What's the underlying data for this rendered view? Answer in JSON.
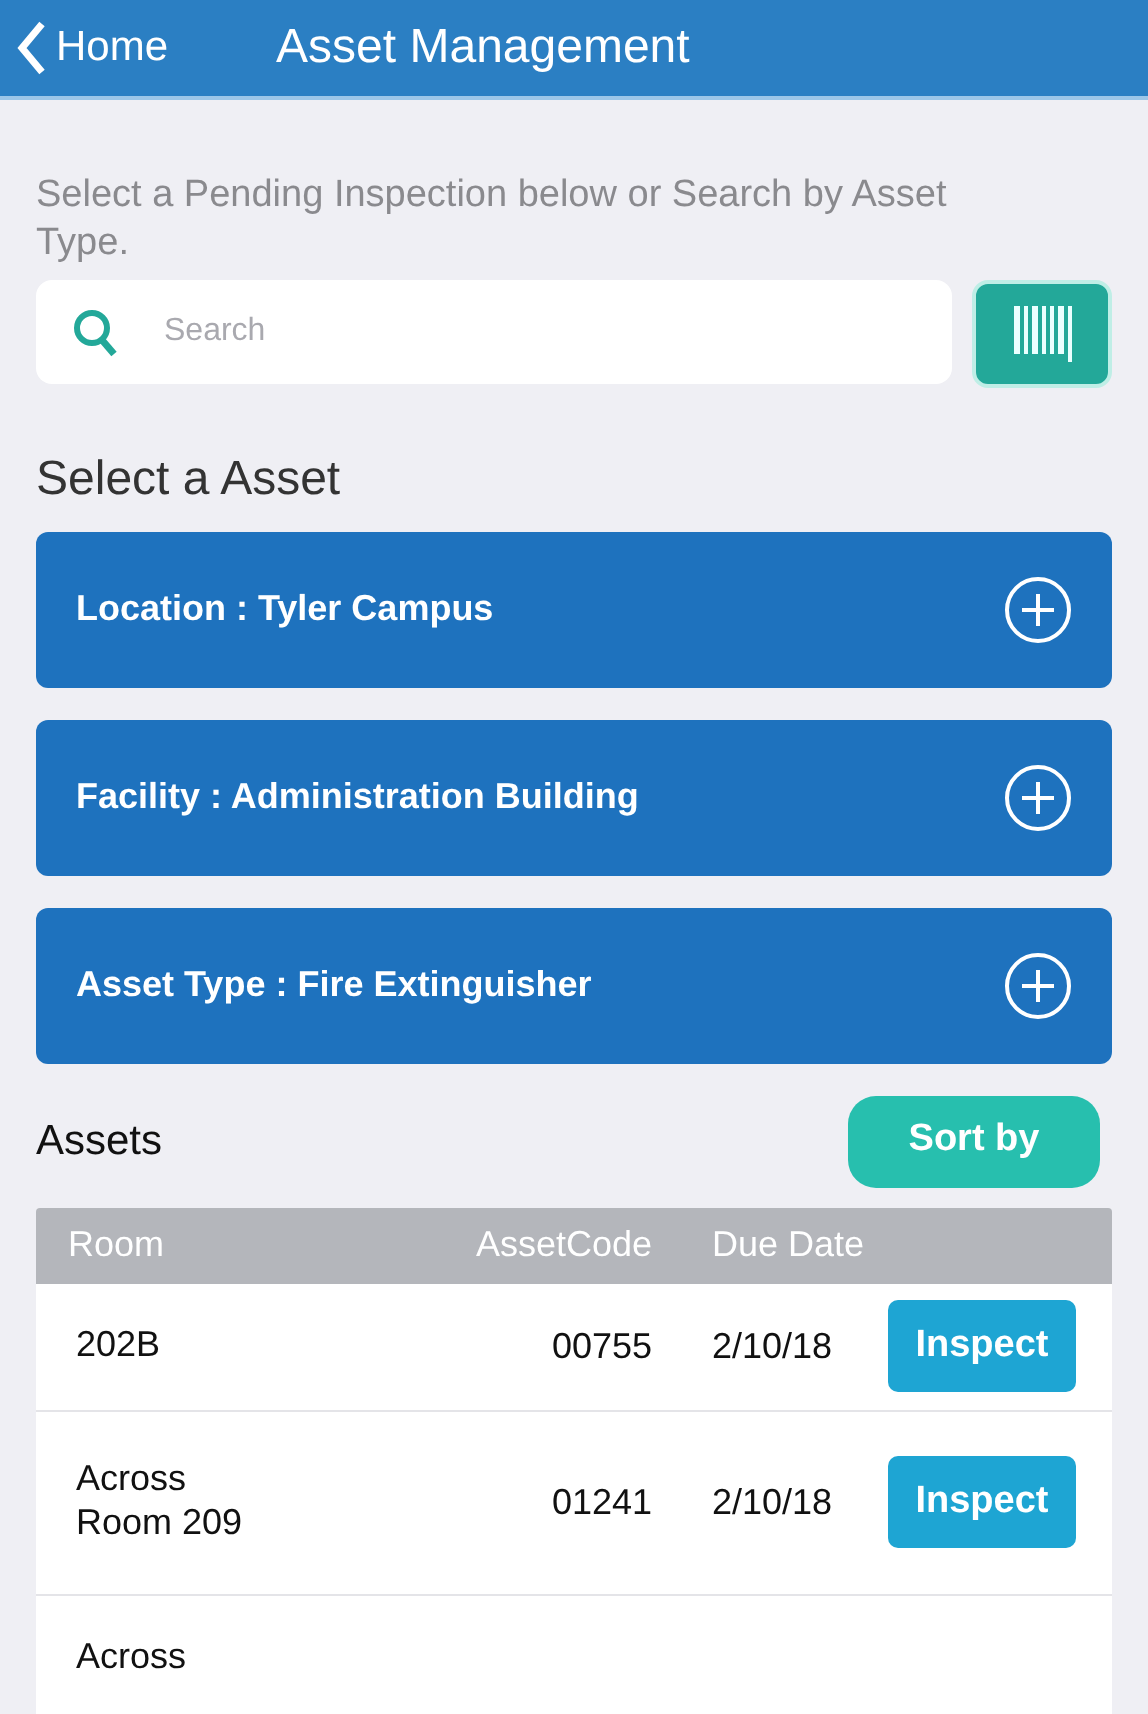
{
  "header": {
    "back_label": "Home",
    "title": "Asset Management"
  },
  "intro": "Select a Pending Inspection below or Search by Asset Type.",
  "search": {
    "placeholder": "Search"
  },
  "section_title": "Select a Asset",
  "filters": [
    {
      "label": "Location : Tyler Campus",
      "expanded": false
    },
    {
      "label": "Facility : Administration Building",
      "expanded": false
    },
    {
      "label": "Asset Type : Fire Extinguisher",
      "expanded": false
    }
  ],
  "assets": {
    "title": "Assets",
    "sort_button": "Sort by",
    "columns": [
      "Room",
      "AssetCode",
      "Due Date"
    ],
    "rows": [
      {
        "room": "202B",
        "code": "00755",
        "due": "2/10/18",
        "action": "Inspect"
      },
      {
        "room": "Across Room 209",
        "code": "01241",
        "due": "2/10/18",
        "action": "Inspect"
      },
      {
        "room": "Across"
      }
    ]
  }
}
